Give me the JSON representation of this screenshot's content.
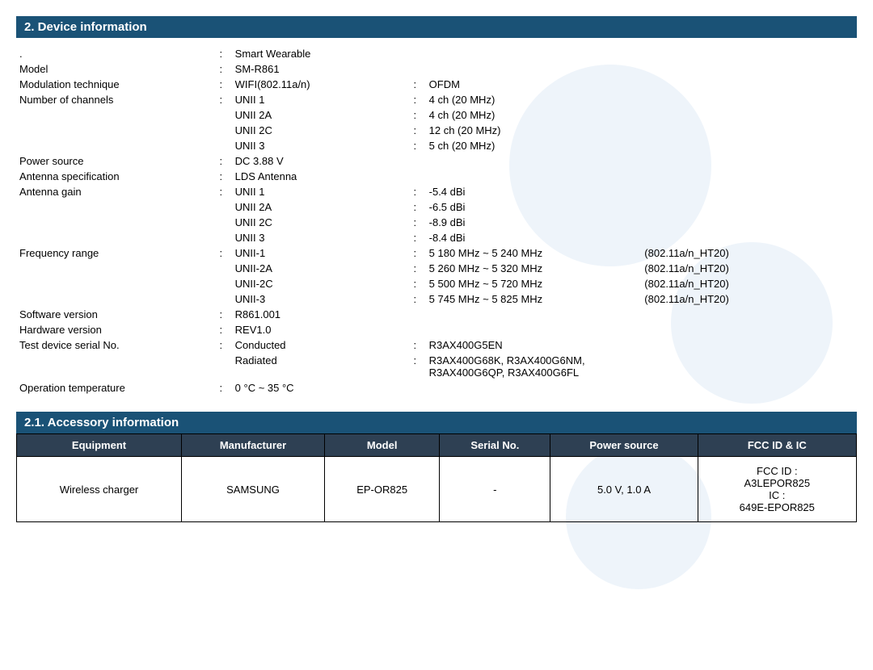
{
  "section2": {
    "title": "2.    Device information",
    "rows": [
      {
        "label": ".",
        "colon": ":",
        "value": "Smart Wearable",
        "colon2": "",
        "value2": "",
        "extra": ""
      },
      {
        "label": "Model",
        "colon": ":",
        "value": "SM-R861",
        "colon2": "",
        "value2": "",
        "extra": ""
      },
      {
        "label": "Modulation technique",
        "colon": ":",
        "value": "WIFI(802.11a/n)",
        "colon2": ":",
        "value2": "OFDM",
        "extra": ""
      },
      {
        "label": "Number of channels",
        "colon": ":",
        "value": "UNII 1",
        "colon2": ":",
        "value2": "4 ch (20 MHz)",
        "extra": ""
      },
      {
        "label": "",
        "colon": "",
        "value": "UNII 2A",
        "colon2": ":",
        "value2": "4 ch (20 MHz)",
        "extra": ""
      },
      {
        "label": "",
        "colon": "",
        "value": "UNII 2C",
        "colon2": ":",
        "value2": "12 ch (20 MHz)",
        "extra": ""
      },
      {
        "label": "",
        "colon": "",
        "value": "UNII 3",
        "colon2": ":",
        "value2": "5 ch (20 MHz)",
        "extra": ""
      },
      {
        "label": "Power source",
        "colon": ":",
        "value": "DC 3.88 V",
        "colon2": "",
        "value2": "",
        "extra": ""
      },
      {
        "label": "Antenna specification",
        "colon": ":",
        "value": "LDS Antenna",
        "colon2": "",
        "value2": "",
        "extra": ""
      },
      {
        "label": "Antenna gain",
        "colon": ":",
        "value": "UNII 1",
        "colon2": ":",
        "value2": "-5.4  dBi",
        "extra": ""
      },
      {
        "label": "",
        "colon": "",
        "value": "UNII 2A",
        "colon2": ":",
        "value2": "-6.5  dBi",
        "extra": ""
      },
      {
        "label": "",
        "colon": "",
        "value": "UNII 2C",
        "colon2": ":",
        "value2": "-8.9  dBi",
        "extra": ""
      },
      {
        "label": "",
        "colon": "",
        "value": "UNII 3",
        "colon2": ":",
        "value2": "-8.4  dBi",
        "extra": ""
      },
      {
        "label": "Frequency range",
        "colon": ":",
        "value": "UNII-1",
        "colon2": ":",
        "value2": "5 180 MHz ~ 5 240 MHz",
        "extra": "(802.11a/n_HT20)"
      },
      {
        "label": "",
        "colon": "",
        "value": "UNII-2A",
        "colon2": ":",
        "value2": "5 260 MHz ~ 5 320 MHz",
        "extra": "(802.11a/n_HT20)"
      },
      {
        "label": "",
        "colon": "",
        "value": "UNII-2C",
        "colon2": ":",
        "value2": "5 500 MHz ~ 5 720 MHz",
        "extra": "(802.11a/n_HT20)"
      },
      {
        "label": "",
        "colon": "",
        "value": "UNII-3",
        "colon2": ":",
        "value2": "5 745 MHz ~ 5 825 MHz",
        "extra": "(802.11a/n_HT20)"
      },
      {
        "label": "Software version",
        "colon": ":",
        "value": "R861.001",
        "colon2": "",
        "value2": "",
        "extra": ""
      },
      {
        "label": "Hardware version",
        "colon": ":",
        "value": "REV1.0",
        "colon2": "",
        "value2": "",
        "extra": ""
      },
      {
        "label": "Test device serial No.",
        "colon": ":",
        "value": "Conducted",
        "colon2": ":",
        "value2": "R3AX400G5EN",
        "extra": ""
      },
      {
        "label": "",
        "colon": "",
        "value": "Radiated",
        "colon2": ":",
        "value2": "R3AX400G68K, R3AX400G6NM, R3AX400G6QP, R3AX400G6FL",
        "extra": ""
      },
      {
        "label": "Operation temperature",
        "colon": ":",
        "value": "0 °C ~ 35 °C",
        "colon2": "",
        "value2": "",
        "extra": ""
      }
    ]
  },
  "section21": {
    "title": "2.1.   Accessory information",
    "table": {
      "headers": [
        "Equipment",
        "Manufacturer",
        "Model",
        "Serial No.",
        "Power source",
        "FCC ID & IC"
      ],
      "rows": [
        {
          "equipment": "Wireless charger",
          "manufacturer": "SAMSUNG",
          "model": "EP-OR825",
          "serial": "-",
          "power": "5.0 V, 1.0 A",
          "fcc": "FCC ID :\nA3LEPOR825\nIC :\n649E-EPOR825"
        }
      ]
    }
  }
}
